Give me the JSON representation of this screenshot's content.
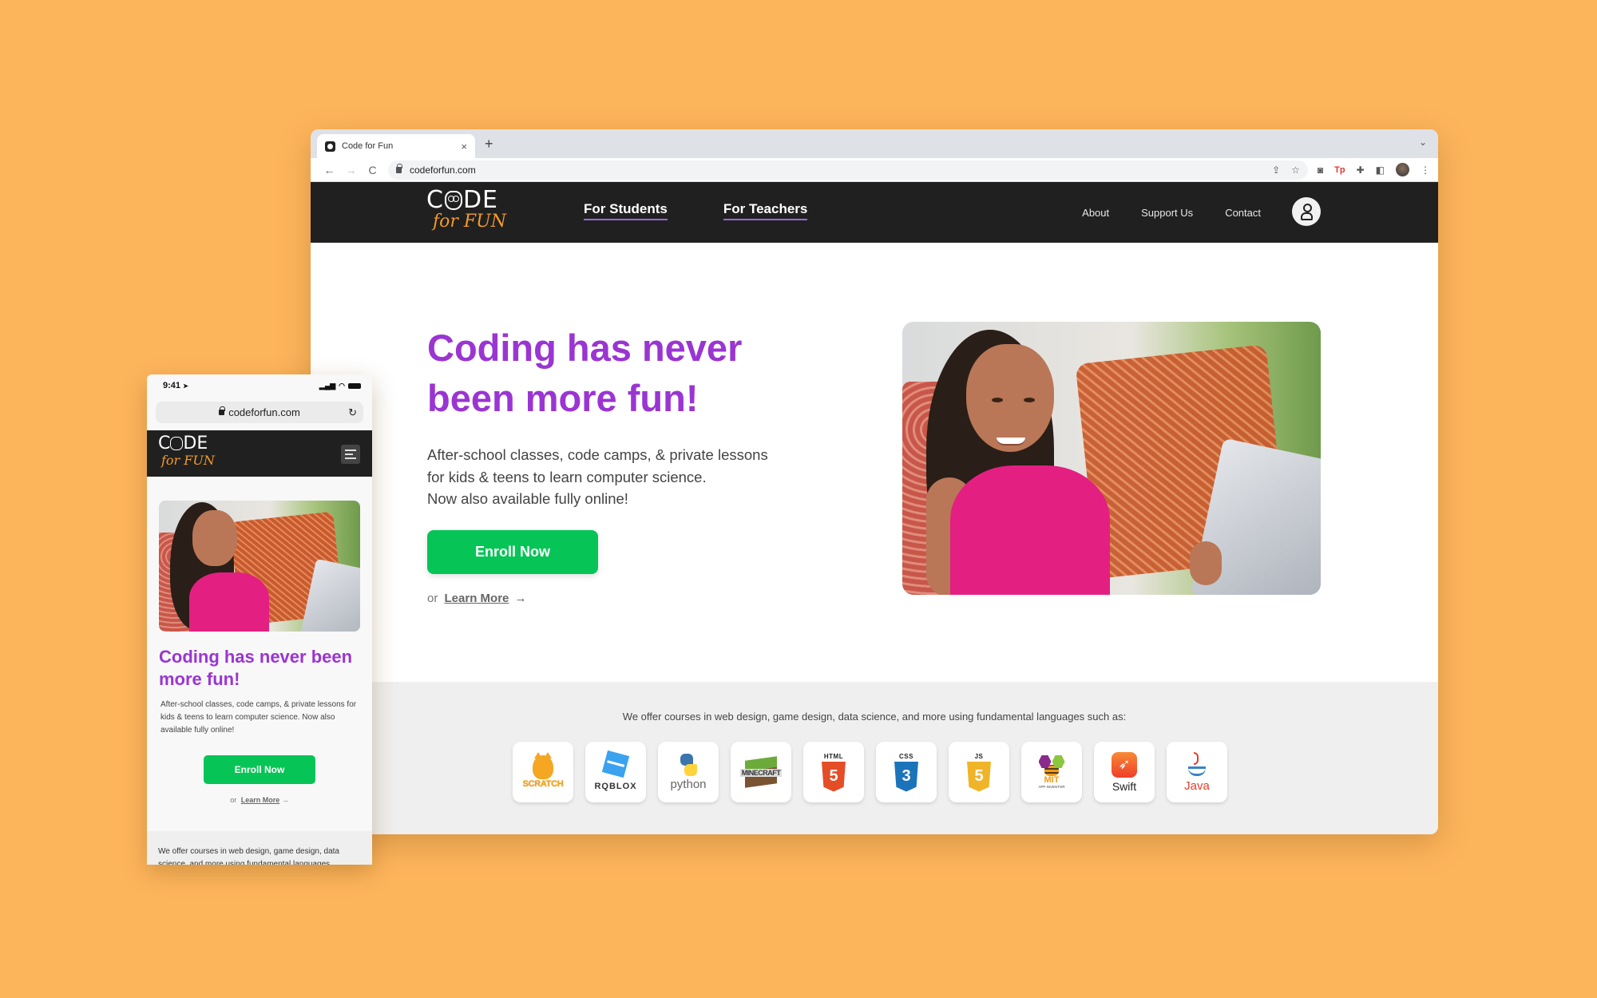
{
  "browser": {
    "tab_title": "Code for Fun",
    "tab_close": "×",
    "new_tab": "+",
    "tab_menu": "⌄",
    "nav": {
      "back": "←",
      "forward": "→",
      "reload": "C"
    },
    "url": "codeforfun.com",
    "omnibox_icons": [
      "share-icon",
      "star-icon"
    ],
    "extensions": [
      "camera-icon",
      "tp-extension-icon",
      "puzzle-icon",
      "side-panel-icon",
      "profile-avatar",
      "kebab-menu-icon"
    ],
    "ext_tp_label": "Tp"
  },
  "site": {
    "brand": {
      "code_left": "C",
      "code_right": "DE",
      "fun": "for FUN"
    },
    "main_nav": [
      "For Students",
      "For Teachers"
    ],
    "secondary_nav": [
      "About",
      "Support Us",
      "Contact"
    ],
    "hero": {
      "title": "Coding has never been more fun!",
      "subtitle_lines": [
        "After-school classes, code camps, & private lessons",
        "for kids & teens to learn computer science.",
        "Now also available fully online!"
      ],
      "enroll_label": "Enroll Now",
      "or_label": "or",
      "learn_more_label": "Learn More",
      "arrow": "→"
    },
    "languages": {
      "caption": "We offer courses in web design, game design, data science, and more using fundamental languages such as:",
      "items": [
        {
          "name": "Scratch",
          "label": "SCRATCH"
        },
        {
          "name": "Roblox",
          "label": "RQBLOX"
        },
        {
          "name": "Python",
          "label": "python"
        },
        {
          "name": "Minecraft",
          "label": "MINECRAFT"
        },
        {
          "name": "HTML",
          "label": "HTML",
          "glyph": "5",
          "color": "#e44d26"
        },
        {
          "name": "CSS",
          "label": "CSS",
          "glyph": "3",
          "color": "#1b73ba"
        },
        {
          "name": "JS",
          "label": "JS",
          "glyph": "5",
          "color": "#f0b429"
        },
        {
          "name": "MIT App Inventor",
          "label": "MIT",
          "sublabel": "APP INVENTOR"
        },
        {
          "name": "Swift",
          "label": "Swift"
        },
        {
          "name": "Java",
          "label": "Java"
        }
      ]
    }
  },
  "mobile": {
    "time": "9:41",
    "location_arrow": "➤",
    "signal": "▂▄▆",
    "url": "codeforfun.com",
    "reload": "↻",
    "hero": {
      "title": "Coding has never been more fun!",
      "subtitle": "After-school classes, code camps, & private lessons for kids & teens to learn computer science. Now also available fully online!",
      "enroll_label": "Enroll Now",
      "or_label": "or",
      "learn_more_label": "Learn More",
      "arrow": "→"
    },
    "languages_caption": "We offer courses in web design, game design, data science, and more using fundamental languages"
  },
  "colors": {
    "background": "#fdb55c",
    "header": "#202020",
    "accent_purple": "#9a35d2",
    "cta_green": "#07c456",
    "brand_orange": "#f39a2b"
  }
}
